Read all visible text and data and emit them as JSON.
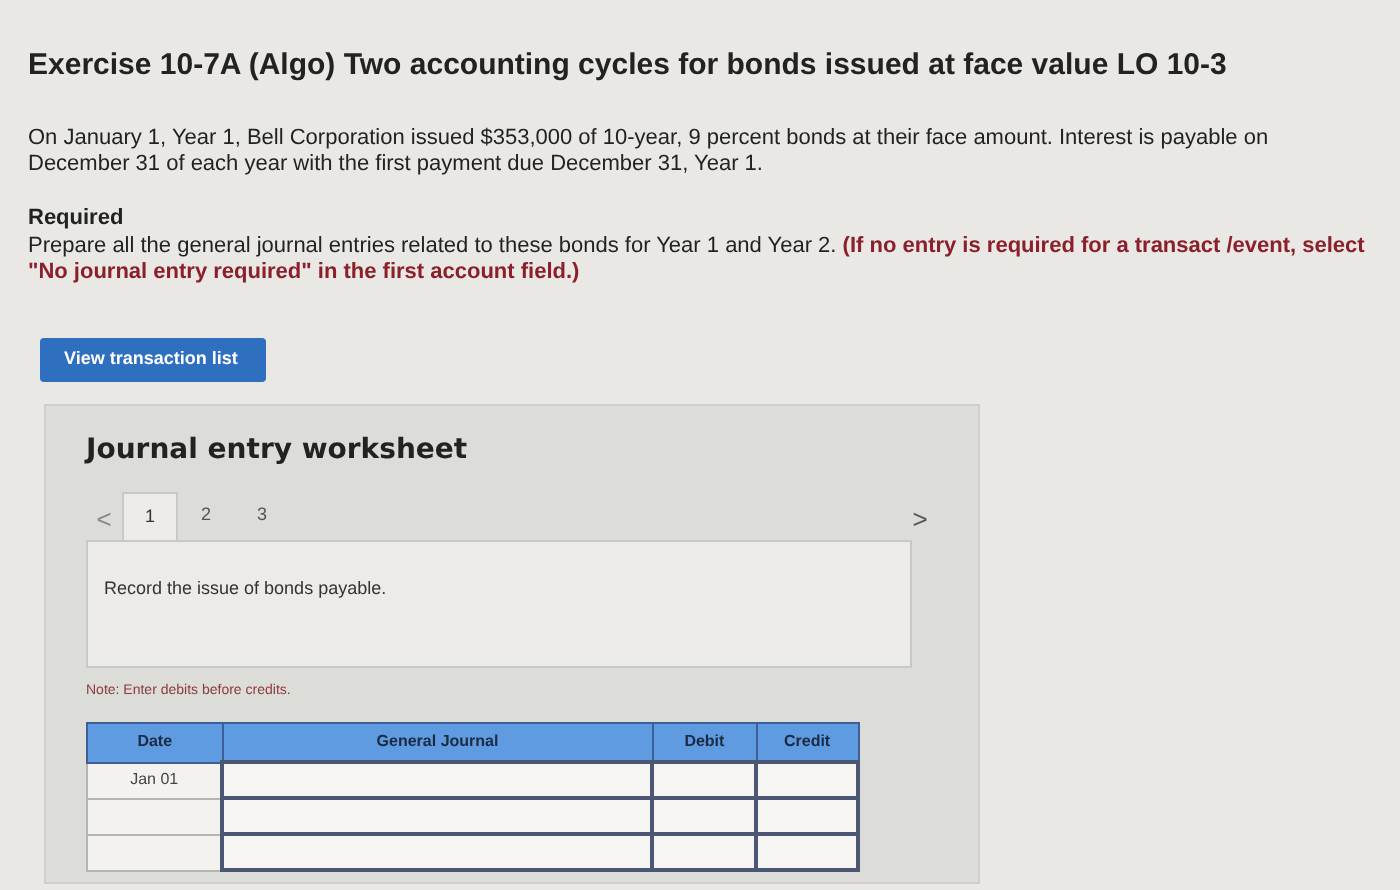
{
  "title": "Exercise 10-7A (Algo) Two accounting cycles for bonds issued at face value LO 10-3",
  "intro": "On January 1, Year 1, Bell Corporation issued $353,000 of 10-year, 9 percent bonds at their face amount. Interest is payable on December 31 of each year with the first payment due December 31, Year 1.",
  "required": {
    "heading": "Required",
    "text": "Prepare all the general journal entries related to these bonds for Year 1 and Year 2. **(If no entry is required for a transact /event, select \"No journal entry required\" in the first account field.)**"
  },
  "button": "View transaction list",
  "worksheet": {
    "title": "Journal entry worksheet",
    "prev": "<",
    "next": ">",
    "tabs": [
      {
        "label": "1",
        "selected": true
      },
      {
        "label": "2",
        "selected": false
      },
      {
        "label": "3",
        "selected": false
      }
    ],
    "description": "Record the issue of bonds payable.",
    "note": "Note: Enter debits before credits.",
    "table": {
      "columns": [
        "Date",
        "General Journal",
        "Debit",
        "Credit"
      ],
      "rows": [
        {
          "date": "Jan 01"
        },
        {},
        {}
      ]
    }
  }
}
